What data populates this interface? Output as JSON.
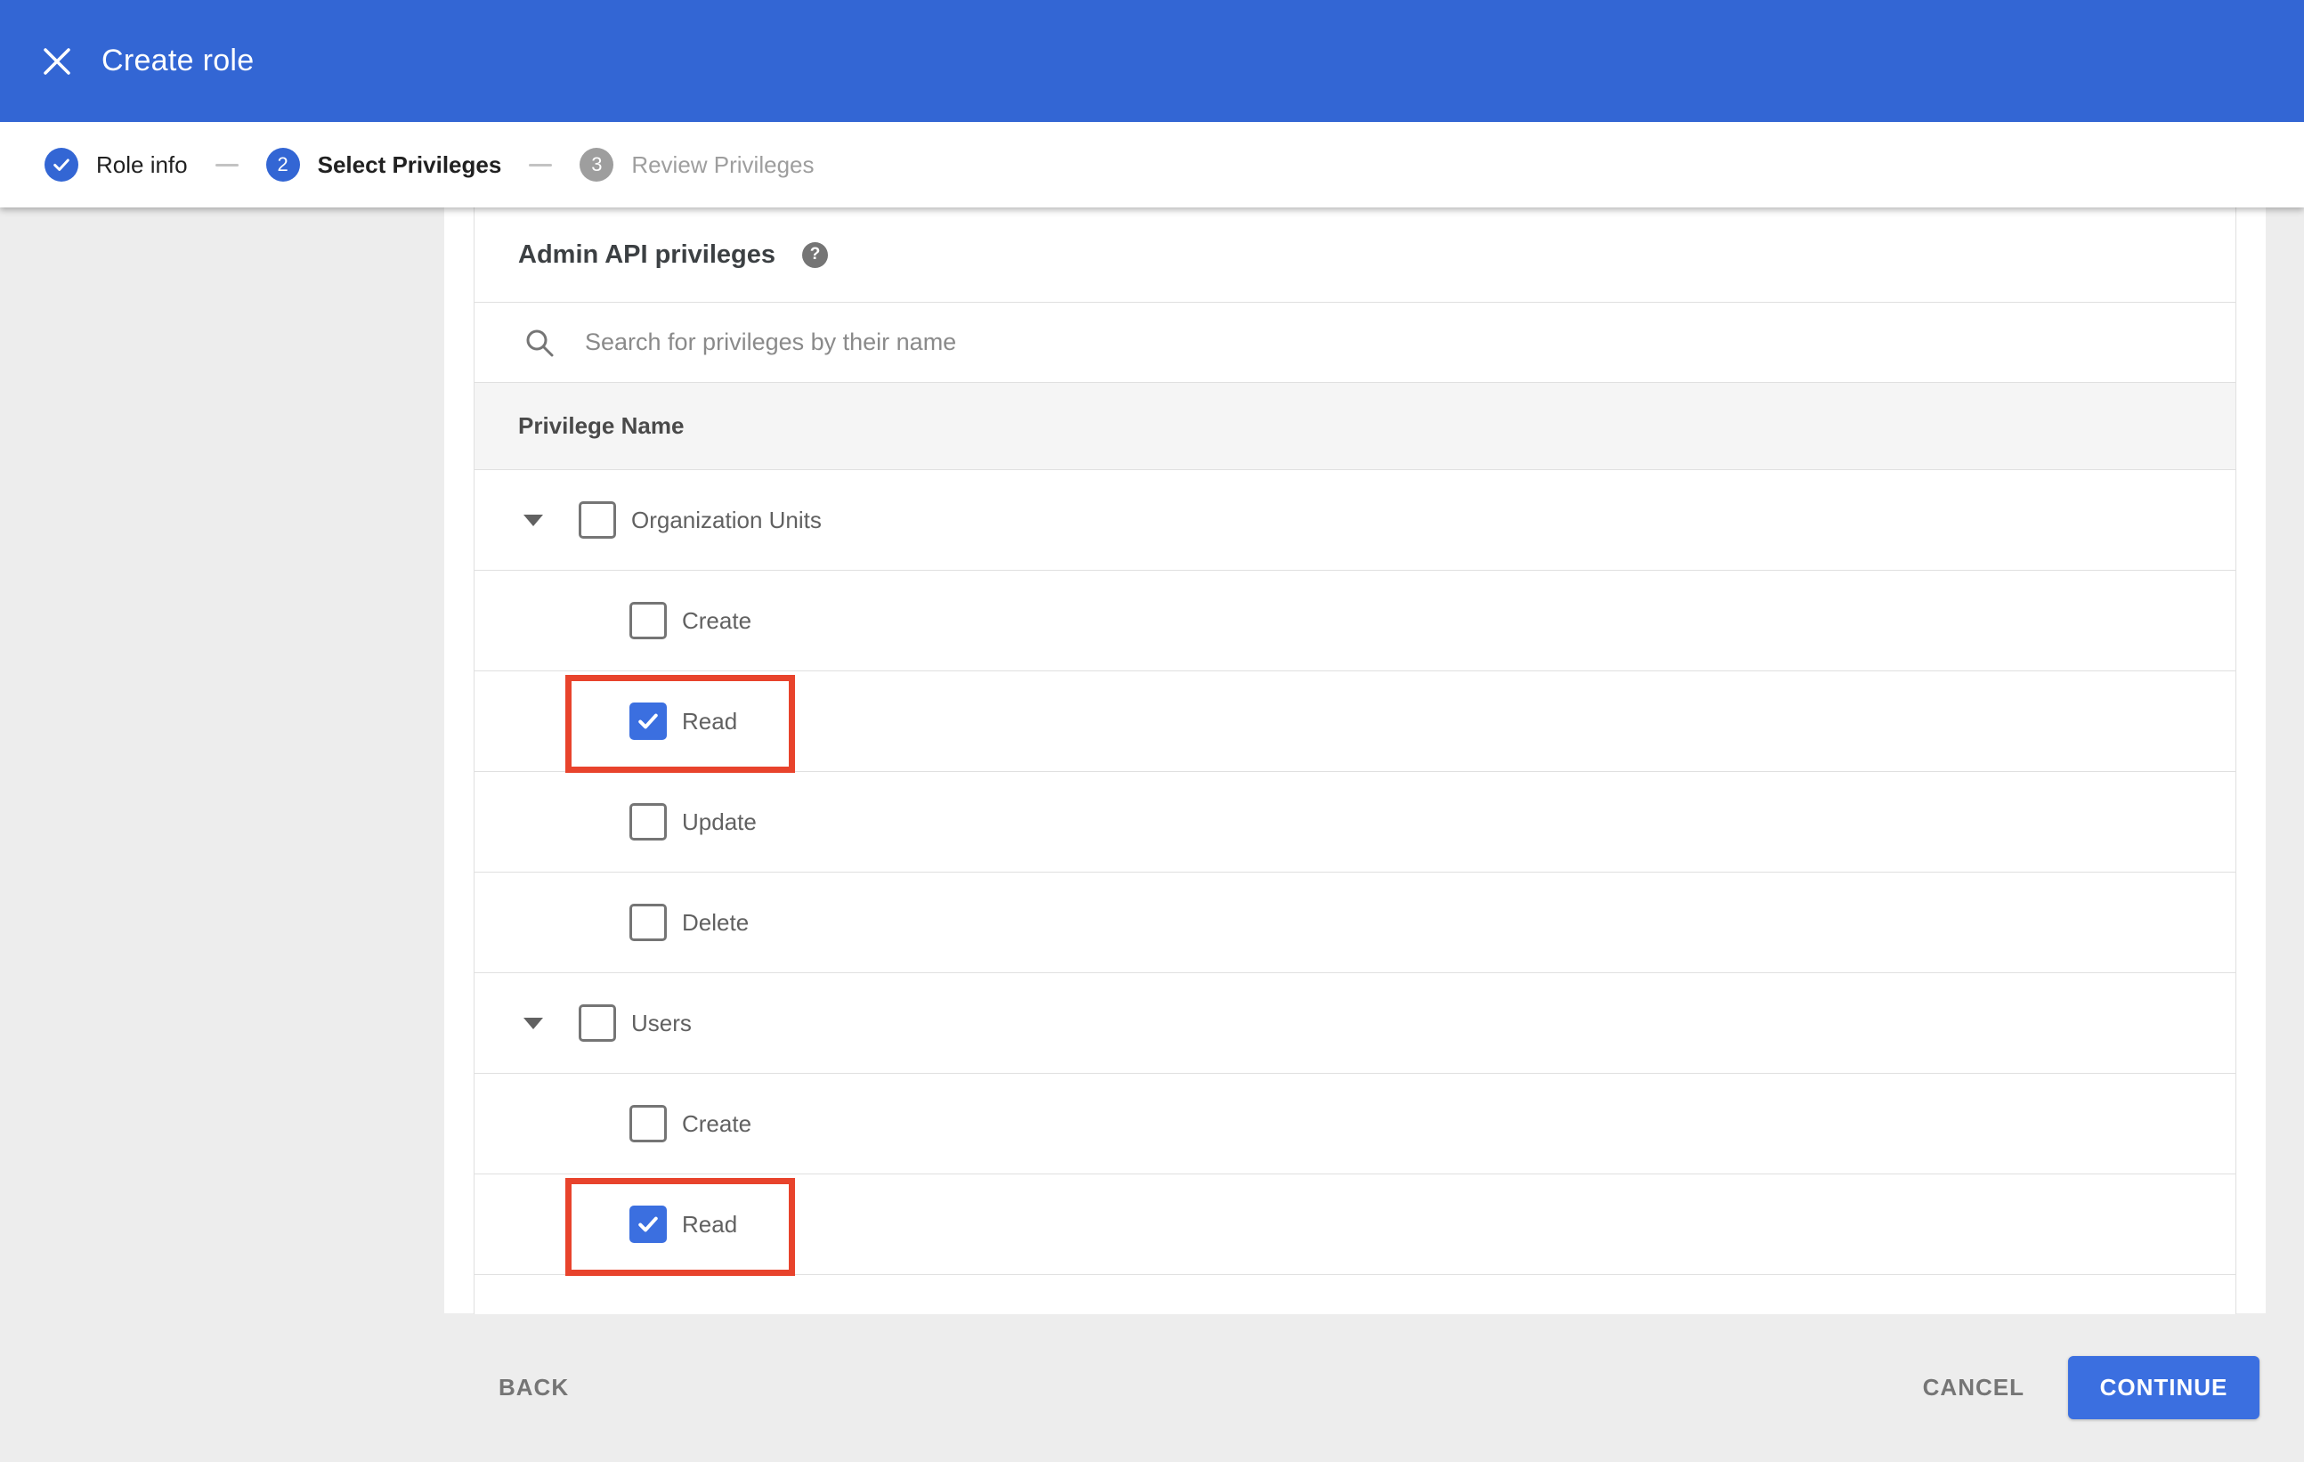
{
  "header": {
    "title": "Create role"
  },
  "stepper": {
    "steps": [
      {
        "number": "",
        "label": "Role info",
        "state": "complete"
      },
      {
        "number": "2",
        "label": "Select Privileges",
        "state": "active"
      },
      {
        "number": "3",
        "label": "Review Privileges",
        "state": "upcoming"
      }
    ]
  },
  "privileges": {
    "section_title": "Admin API privileges",
    "search_placeholder": "Search for privileges by their name",
    "column_header": "Privilege Name",
    "groups": [
      {
        "label": "Organization Units",
        "checked": false,
        "expanded": true,
        "children": [
          {
            "label": "Create",
            "checked": false,
            "highlighted": false
          },
          {
            "label": "Read",
            "checked": true,
            "highlighted": true
          },
          {
            "label": "Update",
            "checked": false,
            "highlighted": false
          },
          {
            "label": "Delete",
            "checked": false,
            "highlighted": false
          }
        ]
      },
      {
        "label": "Users",
        "checked": false,
        "expanded": true,
        "children": [
          {
            "label": "Create",
            "checked": false,
            "highlighted": false
          },
          {
            "label": "Read",
            "checked": true,
            "highlighted": true
          }
        ]
      }
    ]
  },
  "footer": {
    "back_label": "BACK",
    "cancel_label": "CANCEL",
    "continue_label": "CONTINUE"
  },
  "icons": {
    "help_glyph": "?"
  },
  "colors": {
    "header_blue": "#3366d4",
    "accent_blue": "#3b6fe0",
    "highlight_red": "#e8432c",
    "background_gray": "#ededed",
    "table_border": "#e0e0e0",
    "thead_bg": "#f5f5f5"
  }
}
